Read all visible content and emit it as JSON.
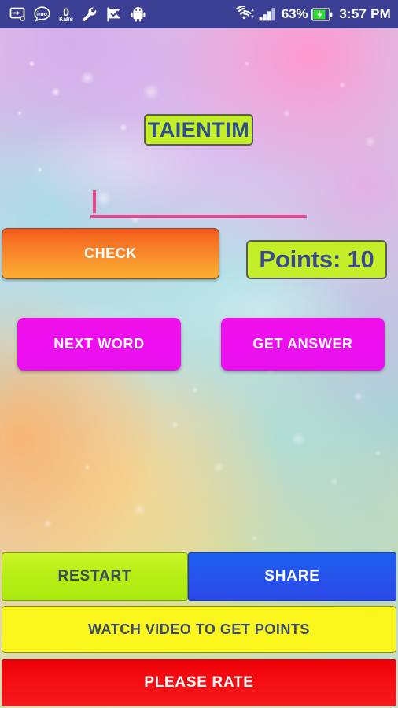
{
  "status_bar": {
    "background_color": "#3b3f94",
    "left_icons": [
      {
        "name": "screen-cast-icon",
        "glyph": "cast"
      },
      {
        "name": "imo-messenger-icon",
        "glyph": "imo"
      },
      {
        "name": "data-speed-icon",
        "value": "0",
        "unit": "KB/s"
      },
      {
        "name": "wrench-settings-icon",
        "glyph": "wrench"
      },
      {
        "name": "checkmark-flag-icon",
        "glyph": "check"
      },
      {
        "name": "android-robot-icon",
        "glyph": "android"
      }
    ],
    "data_speed_value": "0",
    "data_speed_unit": "KB/s",
    "wifi_label": "wifi-icon",
    "signal_label": "cellular-signal-icon",
    "battery_percent": "63%",
    "battery_state": "charging",
    "time": "3:57 PM"
  },
  "game": {
    "scrambled_word": "TAIENTIM",
    "word_label_bg": "#c4ef28",
    "word_label_text_color": "#2f4f8f",
    "answer_value": "",
    "answer_placeholder": "",
    "answer_underline_color": "#e8468c",
    "points_text": "Points: 10",
    "points_value": 10,
    "points_bg": "#c4ef28",
    "points_text_color": "#3a4a8c"
  },
  "buttons": {
    "check": {
      "label": "CHECK",
      "bg": "#f8852a",
      "text_color": "#ffffff"
    },
    "next_word": {
      "label": "NEXT WORD",
      "bg": "#ee0ff0",
      "text_color": "#ffffff"
    },
    "get_answer": {
      "label": "GET ANSWER",
      "bg": "#ee0ff0",
      "text_color": "#ffffff"
    },
    "restart": {
      "label": "RESTART",
      "bg": "#b6ee15",
      "text_color": "#3c4a5c"
    },
    "share": {
      "label": "SHARE",
      "bg": "#2753ea",
      "text_color": "#ffffff"
    },
    "watch_video": {
      "label": "WATCH VIDEO TO GET POINTS",
      "bg": "#fbf71c",
      "text_color": "#3c4a6e"
    },
    "please_rate": {
      "label": "PLEASE RATE",
      "bg": "#f50d12",
      "text_color": "#ffffff"
    }
  }
}
